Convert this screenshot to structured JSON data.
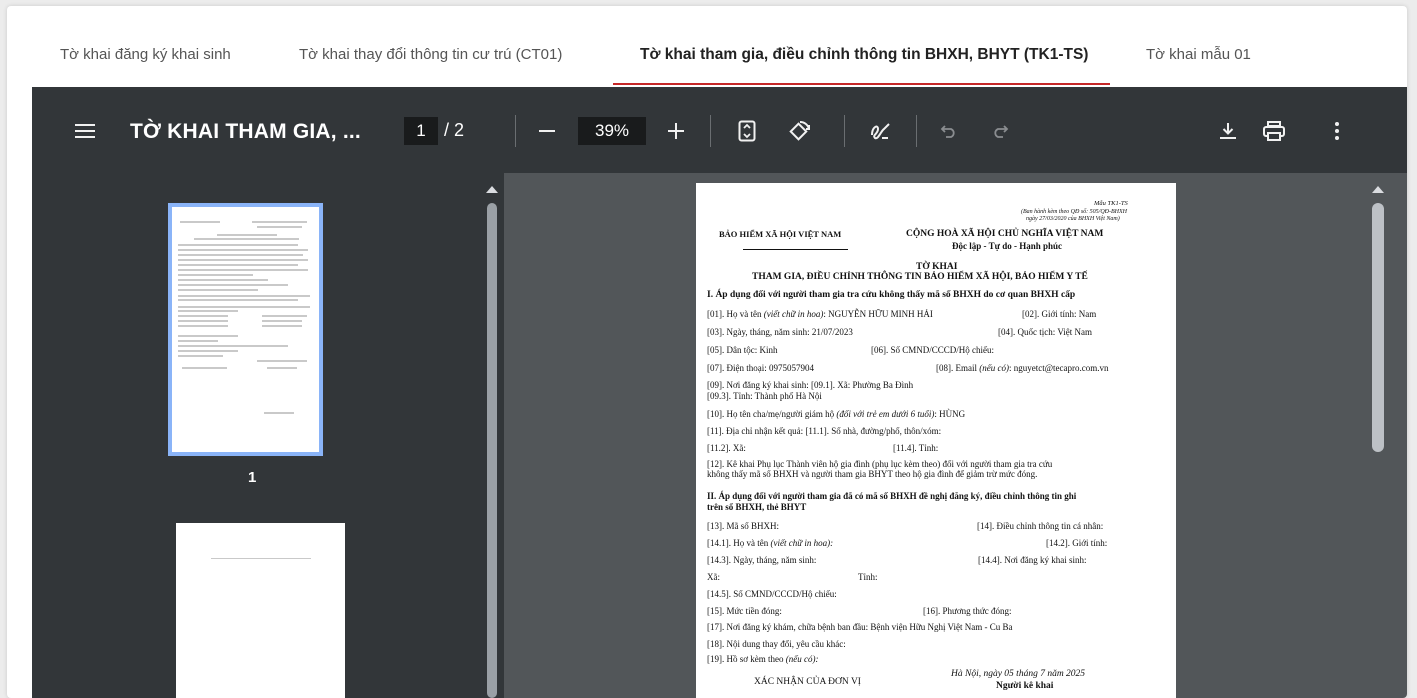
{
  "tabs": [
    {
      "label": "Tờ khai đăng ký khai sinh"
    },
    {
      "label": "Tờ khai thay đổi thông tin cư trú (CT01)"
    },
    {
      "label": "Tờ khai tham gia, điều chỉnh thông tin BHXH, BHYT (TK1-TS)"
    },
    {
      "label": "Tờ khai mẫu 01"
    }
  ],
  "toolbar": {
    "title": "TỜ KHAI THAM GIA, ...",
    "current_page": "1",
    "total_pages": "/ 2",
    "zoom": "39%",
    "icons": [
      "menu-icon",
      "zoom-out-icon",
      "zoom-in-icon",
      "fit-page-icon",
      "rotate-icon",
      "annotate-icon",
      "undo-icon",
      "redo-icon",
      "download-icon",
      "print-icon",
      "more-icon"
    ]
  },
  "sidebar": {
    "thumb_label": "1"
  },
  "doc": {
    "form_no": "Mẫu TK1-TS",
    "decree1": "(Ban hành kèm theo QĐ số: 505/QĐ-BHXH",
    "decree2": "ngày 27/03/2020 của BHXH Việt Nam)",
    "org": "BẢO HIỂM XÃ HỘI VIỆT NAM",
    "republic": "CỘNG HOÀ XÃ HỘI CHỦ NGHĨA VIỆT NAM",
    "motto": "Độc lập - Tự do - Hạnh phúc",
    "title1": "TỜ KHAI",
    "title2": "THAM GIA, ĐIỀU CHỈNH THÔNG TIN BẢO HIỂM XÃ HỘI, BẢO HIỂM Y TẾ",
    "sec1": "I. Áp dụng đối với người tham gia tra cứu không thấy mã số BHXH do cơ quan BHXH cấp",
    "f01_label": "[01]. Họ và tên ",
    "f01_hint": "(viết chữ in hoa)",
    "f01_value": ": NGUYỄN HỮU MINH HẢI",
    "f02": "[02]. Giới tính: Nam",
    "f03": "[03]. Ngày, tháng, năm sinh: 21/07/2023",
    "f04": "[04]. Quốc tịch: Việt Nam",
    "f05": "[05]. Dân tộc: Kinh",
    "f06": "[06]. Số CMND/CCCD/Hộ chiếu:",
    "f07": "[07]. Điện thoại: 0975057904",
    "f08_label": "[08]. Email ",
    "f08_hint": "(nếu có)",
    "f08_value": ": nguyetct@tecapro.com.vn",
    "f09": "[09]. Nơi đăng ký khai sinh: [09.1]. Xã: Phường Ba Đình",
    "f093": "[09.3]. Tỉnh: Thành phố Hà Nội",
    "f10_label": "[10]. Họ tên cha/mẹ/người giám hộ ",
    "f10_hint": "(đối với trẻ em dưới 6 tuổi)",
    "f10_value": ": HÙNG",
    "f11": "[11]. Địa chỉ nhận kết quả: [11.1]. Số nhà, đường/phố, thôn/xóm:",
    "f112": "[11.2]. Xã:",
    "f114": "[11.4]. Tỉnh:",
    "f12a": "[12]. Kê khai Phụ lục Thành viên hộ gia đình (phụ lục kèm theo) đối với người tham gia tra cứu",
    "f12b": "không thấy mã số BHXH và người tham gia BHYT theo hộ gia đình để giảm trừ mức đóng.",
    "sec2a": "II. Áp dụng đối với người tham gia đã có mã số BHXH đề nghị đăng ký, điều chỉnh thông tin ghi",
    "sec2b": "trên sổ BHXH, thẻ BHYT",
    "f13": "[13]. Mã số BHXH:",
    "f14": "[14]. Điều chỉnh thông tin cá nhân:",
    "f141_label": "[14.1]. Họ và tên ",
    "f141_hint": "(viết chữ in hoa):",
    "f142": "[14.2]. Giới tính:",
    "f143": "[14.3]. Ngày, tháng, năm sinh:",
    "f144": "[14.4]. Nơi đăng ký khai sinh:",
    "xa": "Xã:",
    "tinh": "Tỉnh:",
    "f145": "[14.5]. Số CMND/CCCD/Hộ chiếu:",
    "f15": "[15]. Mức tiền đóng:",
    "f16": "[16]. Phương thức đóng:",
    "f17": "[17]. Nơi đăng ký khám, chữa bệnh ban đầu: Bệnh viện Hữu Nghị Việt Nam - Cu Ba",
    "f18": "[18]. Nội dung thay đổi, yêu cầu khác:",
    "f19_label": "[19]. Hồ sơ kèm theo ",
    "f19_hint": "(nếu có):",
    "date": "Hà Nội, ngày 05 tháng 7 năm 2025",
    "confirm": "XÁC NHẬN CỦA ĐƠN VỊ",
    "declarant": "Người kê khai"
  }
}
